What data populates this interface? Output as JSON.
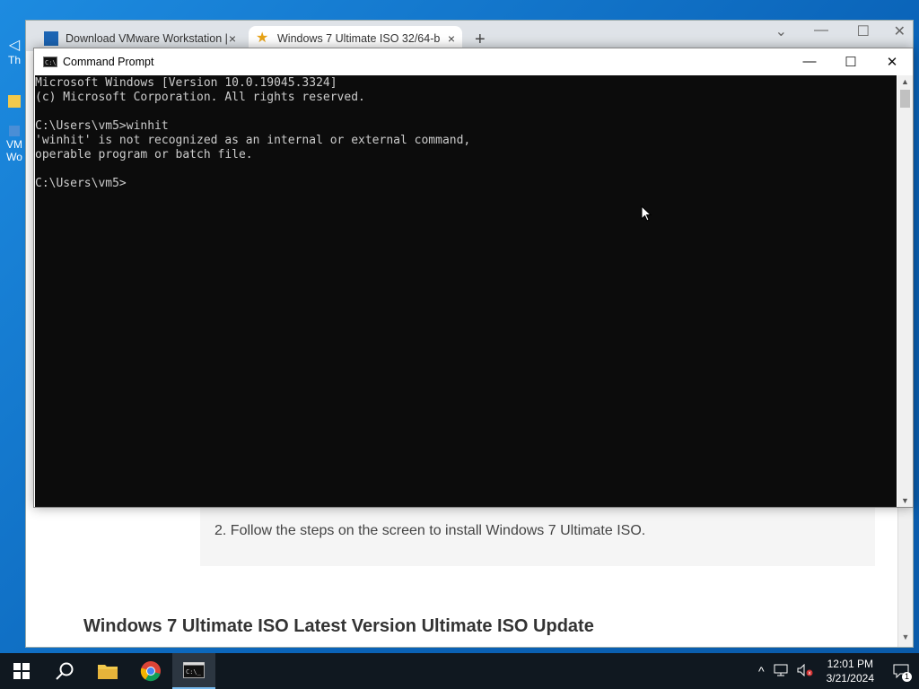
{
  "browser": {
    "tabs": [
      {
        "label": "Download VMware Workstation |",
        "close": "×"
      },
      {
        "label": "Windows 7 Ultimate ISO 32/64-b",
        "close": "×"
      }
    ],
    "new_tab": "+",
    "step_text": "2. Follow the steps on the screen to install Windows 7 Ultimate ISO.",
    "article_heading": "Windows 7 Ultimate ISO Latest Version Ultimate ISO Update",
    "scroll_up": "▲",
    "scroll_down": "▼"
  },
  "cmd": {
    "title": "Command Prompt",
    "icon_text": "C:\\",
    "minimize": "—",
    "maximize": "☐",
    "close": "✕",
    "lines": [
      "Microsoft Windows [Version 10.0.19045.3324]",
      "(c) Microsoft Corporation. All rights reserved.",
      "",
      "C:\\Users\\vm5>winhit",
      "'winhit' is not recognized as an internal or external command,",
      "operable program or batch file.",
      "",
      "C:\\Users\\vm5>"
    ],
    "scroll_up": "▲",
    "scroll_down": "▼"
  },
  "desktop": {
    "icons": [
      {
        "label": "Th"
      },
      {
        "label": "VM\nWo"
      }
    ]
  },
  "taskbar": {
    "start": "⊞",
    "search": "⚲",
    "explorer": "🗀",
    "chrome": "◉",
    "cmd": "▣",
    "tray_chevron": "^",
    "network": "🖧",
    "volume": "🔇",
    "time": "12:01 PM",
    "date": "3/21/2024",
    "notification_count": "1"
  },
  "colors": {
    "console_bg": "#0c0c0c",
    "console_fg": "#cccccc",
    "taskbar_bg": "#101820",
    "desktop_bg": "#0a6fc7"
  }
}
